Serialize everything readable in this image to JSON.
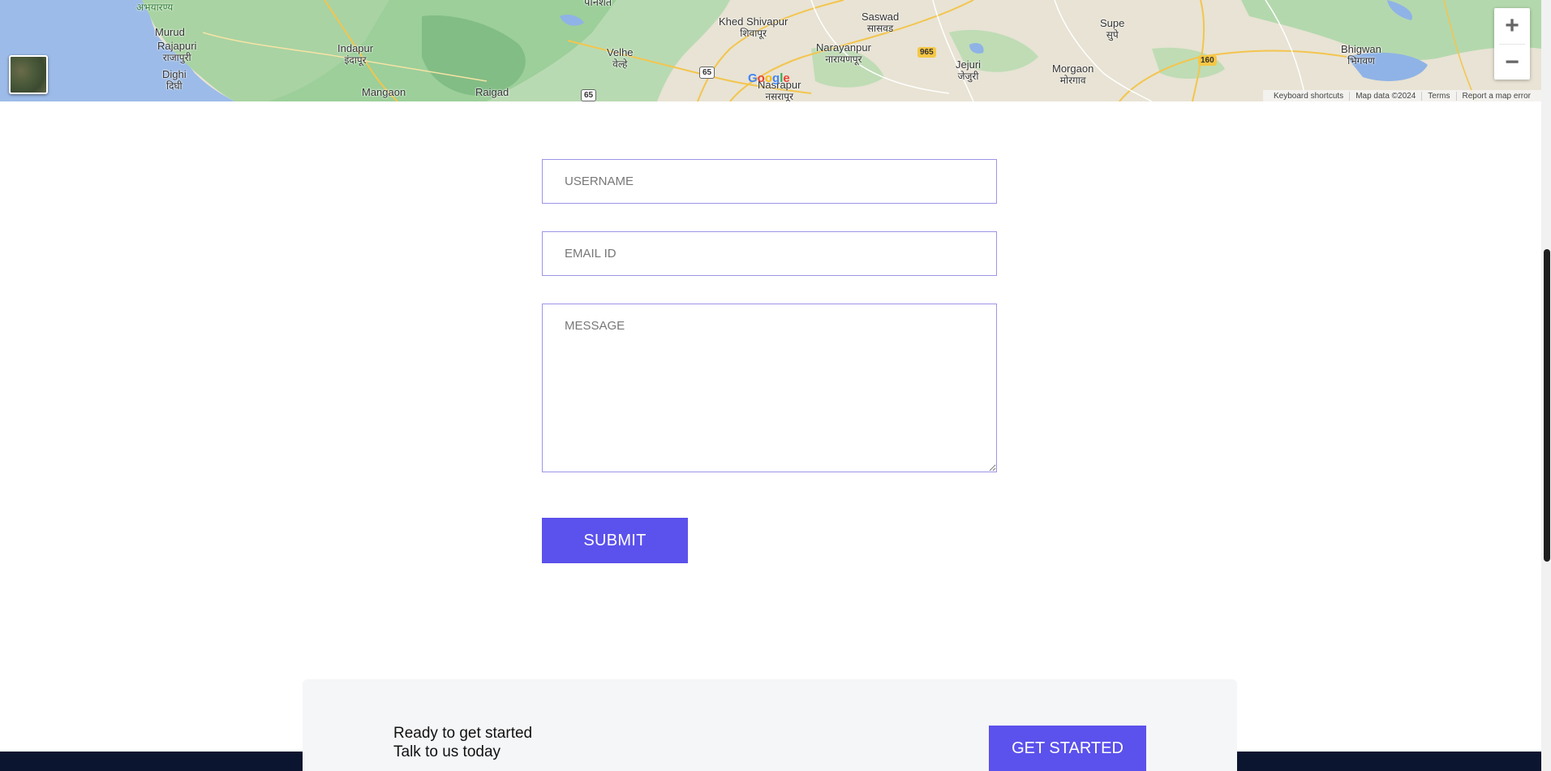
{
  "map": {
    "places": [
      {
        "name": "अभयारण्य",
        "local": ""
      },
      {
        "name": "Murud",
        "local": ""
      },
      {
        "name": "Rajapuri",
        "local": "राजापुरी"
      },
      {
        "name": "Dighi",
        "local": "दिघी"
      },
      {
        "name": "Indapur",
        "local": "इंदापूर"
      },
      {
        "name": "Mangaon",
        "local": ""
      },
      {
        "name": "Raigad",
        "local": ""
      },
      {
        "name": "Velhe",
        "local": "वेल्हे"
      },
      {
        "name": "Khed Shivapur",
        "local": "शिवापूर"
      },
      {
        "name": "Saswad",
        "local": "सासवड"
      },
      {
        "name": "Narayanpur",
        "local": "नारायणपूर"
      },
      {
        "name": "Nasrapur",
        "local": "नसरापूर"
      },
      {
        "name": "Jejuri",
        "local": "जेजुरी"
      },
      {
        "name": "Morgaon",
        "local": "मोरगाव"
      },
      {
        "name": "Supe",
        "local": "सुपे"
      },
      {
        "name": "Bhigwan",
        "local": "भिगवण"
      },
      {
        "name": "पानशेत",
        "local": ""
      }
    ],
    "shields": [
      "965",
      "65",
      "65",
      "160"
    ],
    "zoom_in": "+",
    "zoom_out": "−",
    "google_logo": "Google",
    "footer": {
      "shortcuts": "Keyboard shortcuts",
      "map_data": "Map data ©2024",
      "terms": "Terms",
      "report": "Report a map error"
    }
  },
  "form": {
    "username_placeholder": "USERNAME",
    "email_placeholder": "EMAIL ID",
    "message_placeholder": "MESSAGE",
    "submit_label": "SUBMIT"
  },
  "cta": {
    "line1": "Ready to get started",
    "line2": "Talk to us today",
    "button_label": "GET STARTED"
  },
  "colors": {
    "accent": "#5b51ec",
    "field_border": "#9d95e8",
    "footer_band": "#0c1530",
    "cta_background": "#f5f6f8"
  }
}
